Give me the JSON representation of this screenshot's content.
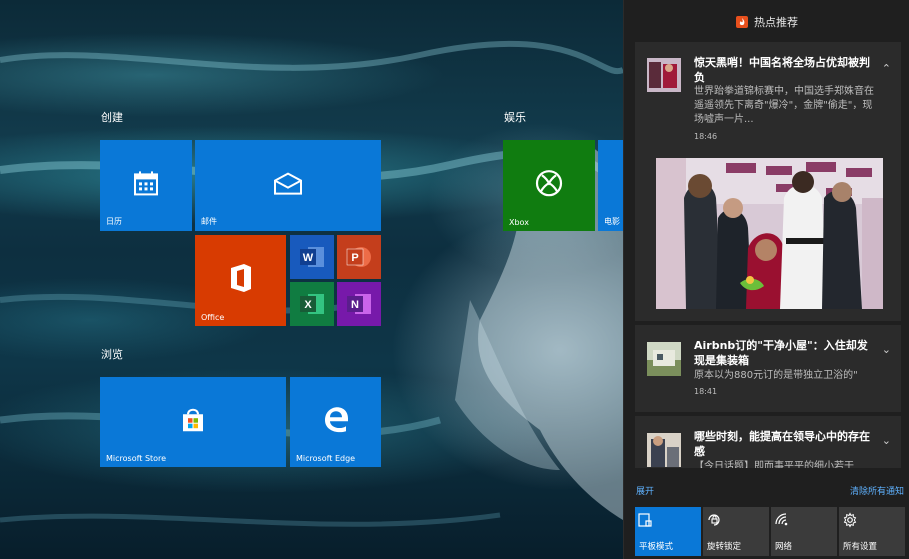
{
  "start": {
    "groups": [
      {
        "label": "创建"
      },
      {
        "label": "浏览"
      },
      {
        "label": "娱乐"
      }
    ],
    "tiles": {
      "calendar": "日历",
      "mail": "邮件",
      "office": "Office",
      "store": "Microsoft Store",
      "edge": "Microsoft Edge",
      "xbox": "Xbox",
      "movies": "电影"
    },
    "office_apps": {
      "word": "W",
      "powerpoint": "P",
      "excel": "X",
      "onenote": "N"
    }
  },
  "action_center": {
    "header_title": "热点推荐",
    "notifications": [
      {
        "title": "惊天黑哨！中国名将全场占优却被判负",
        "body": "世界跆拳道锦标赛中，中国选手郑姝音在遥遥领先下离奇\"爆冷\"，金牌\"偷走\"，现场嘘声一片...",
        "time": "18:46",
        "expanded": true
      },
      {
        "title": "Airbnb订的\"干净小屋\"：入住却发现是集装箱",
        "body": "原本以为880元订的是带独立卫浴的\"",
        "time": "18:41",
        "expanded": false
      },
      {
        "title": "哪些时刻，能提高在领导心中的存在感",
        "body": "【今日话题】即而事平平的细小若干",
        "expanded": false
      }
    ],
    "expand_link": "展开",
    "clear_all_link": "清除所有通知",
    "quick_actions": [
      {
        "label": "平板模式",
        "icon": "tablet-mode-icon",
        "active": true
      },
      {
        "label": "旋转锁定",
        "icon": "rotation-lock-icon",
        "active": false
      },
      {
        "label": "网络",
        "icon": "network-icon",
        "active": false
      },
      {
        "label": "所有设置",
        "icon": "settings-gear-icon",
        "active": false
      }
    ]
  },
  "colors": {
    "tile_blue": "#0a78d7",
    "office_orange": "#d83b01",
    "xbox_green": "#107c10",
    "panel_bg": "#1f1f1f",
    "card_bg": "#2b2b2b",
    "link_blue": "#5fb2ff"
  }
}
